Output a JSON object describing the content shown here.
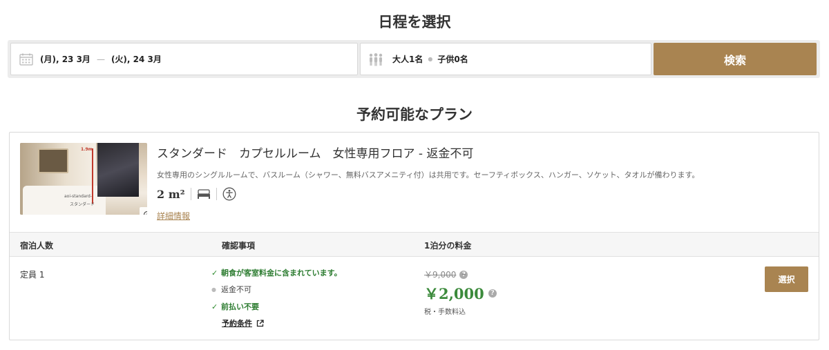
{
  "schedule_title": "日程を選択",
  "search": {
    "checkin": "(月), 23 3月",
    "date_separator": "—",
    "checkout": "(火), 24 3月",
    "adults": "大人1名",
    "children": "子供0名",
    "search_label": "検索"
  },
  "plans_title": "予約可能なプラン",
  "plan": {
    "photo_labels": [
      "1.9m",
      "aoi-standard-",
      "スタンダード"
    ],
    "room_name": "スタンダード　カプセルルーム　女性専用フロア - 返金不可",
    "description": "女性専用のシングルルームで、バスルーム（シャワー、無料バスアメニティ付）は共用です。セーフティボックス、ハンガー、ソケット、タオルが備わります。",
    "size": "2 m²",
    "details_label": "詳細情報",
    "columns": [
      "宿泊人数",
      "確認事項",
      "1泊分の料金"
    ],
    "capacity": "定員 1",
    "conditions": [
      {
        "text": "朝食が客室料金に含まれています。",
        "type": "check"
      },
      {
        "text": "返金不可",
        "type": "dot"
      },
      {
        "text": "前払い不要",
        "type": "check"
      }
    ],
    "terms_label": "予約条件",
    "original_price": "￥9,000",
    "price": "￥2,000",
    "tax_note": "税・手数料込",
    "select_label": "選択"
  },
  "colors": {
    "accent": "#a98451",
    "price_green": "#3b8a3b",
    "check_green": "#2e7d32"
  }
}
